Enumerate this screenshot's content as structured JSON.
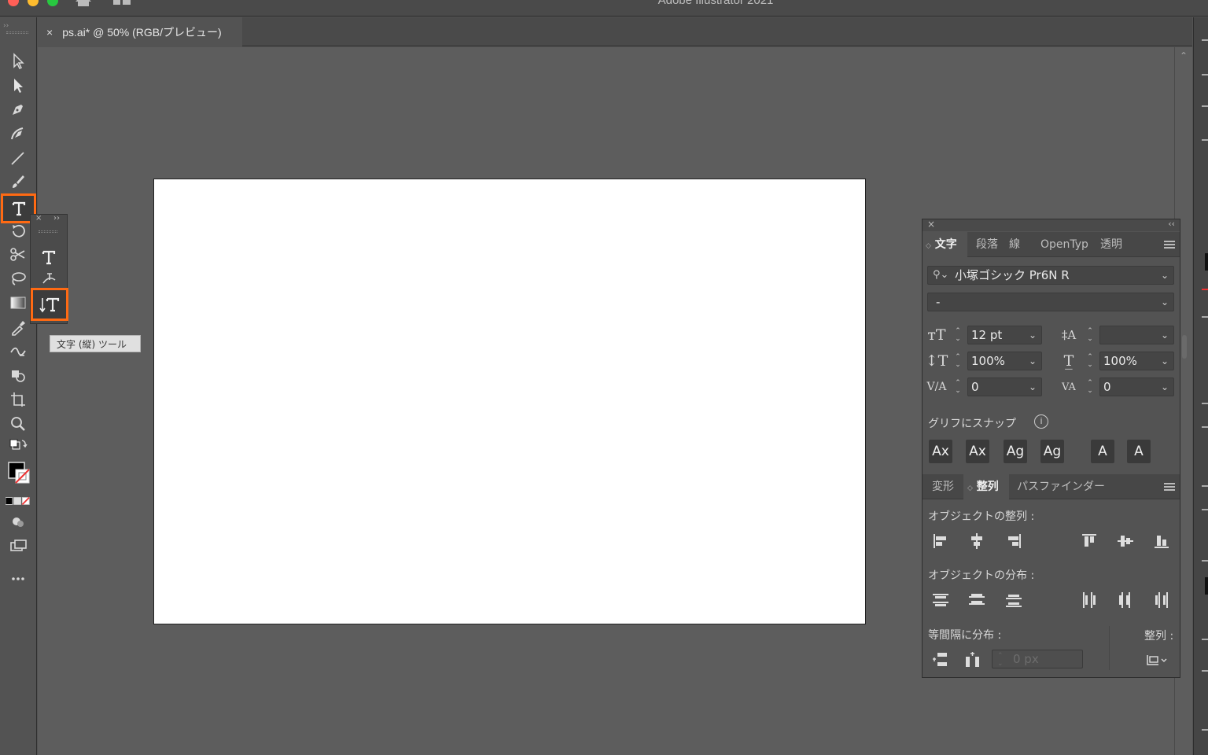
{
  "window": {
    "title": "Adobe Illustrator 2021"
  },
  "document_tab": {
    "close": "×",
    "title": "ps.ai* @ 50% (RGB/プレビュー)"
  },
  "tooltip": "文字 (縦) ツール",
  "character_panel": {
    "tabs": [
      "文字",
      "段落",
      "線",
      "OpenTyp",
      "透明"
    ],
    "active_tab": "文字",
    "font_family": "小塚ゴシック Pr6N R",
    "font_style": "-",
    "font_size": "12 pt",
    "leading": "",
    "vertical_scale": "100%",
    "horizontal_scale": "100%",
    "kerning": "0",
    "tracking": "0",
    "snap_label": "グリフにスナップ",
    "snap_buttons": [
      "Ax",
      "Ax",
      "Ag",
      "Ag",
      "A",
      "A"
    ]
  },
  "align_panel": {
    "tabs": [
      "変形",
      "整列",
      "パスファインダー"
    ],
    "active_tab": "整列",
    "align_objects_label": "オブジェクトの整列 :",
    "distribute_objects_label": "オブジェクトの分布 :",
    "distribute_spacing_label": "等間隔に分布 :",
    "align_to_label": "整列 :",
    "spacing_value": "0 px"
  },
  "colors": {
    "highlight": "#ff6a13",
    "canvas": "#5d5d5d",
    "artboard": "#ffffff"
  }
}
